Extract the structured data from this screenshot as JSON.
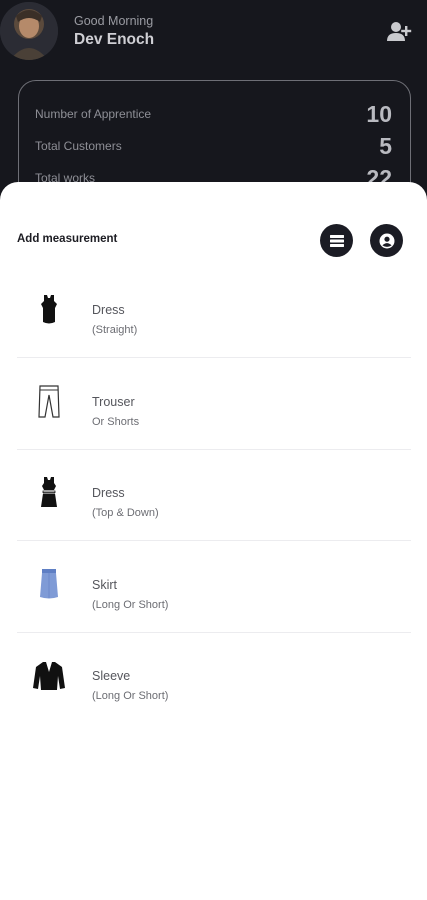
{
  "header": {
    "greeting": "Good Morning",
    "user_name": "Dev Enoch"
  },
  "stats": [
    {
      "label": "Number of Apprentice",
      "value": "10"
    },
    {
      "label": "Total Customers",
      "value": "5"
    },
    {
      "label": "Total works",
      "value": "22"
    }
  ],
  "sheet": {
    "title": "Add measurement",
    "items": [
      {
        "title": "Dress",
        "subtitle": "(Straight)",
        "icon": "dress-icon"
      },
      {
        "title": "Trouser",
        "subtitle": "Or Shorts",
        "icon": "trouser-icon"
      },
      {
        "title": "Dress",
        "subtitle": "(Top & Down)",
        "icon": "top-and-skirt-icon"
      },
      {
        "title": "Skirt",
        "subtitle": "(Long Or Short)",
        "icon": "skirt-icon"
      },
      {
        "title": "Sleeve",
        "subtitle": "(Long Or Short)",
        "icon": "jacket-icon"
      }
    ]
  },
  "colors": {
    "background_dark": "#16171d",
    "sheet": "#ffffff",
    "skirt_blue": "#7f9bd6"
  }
}
